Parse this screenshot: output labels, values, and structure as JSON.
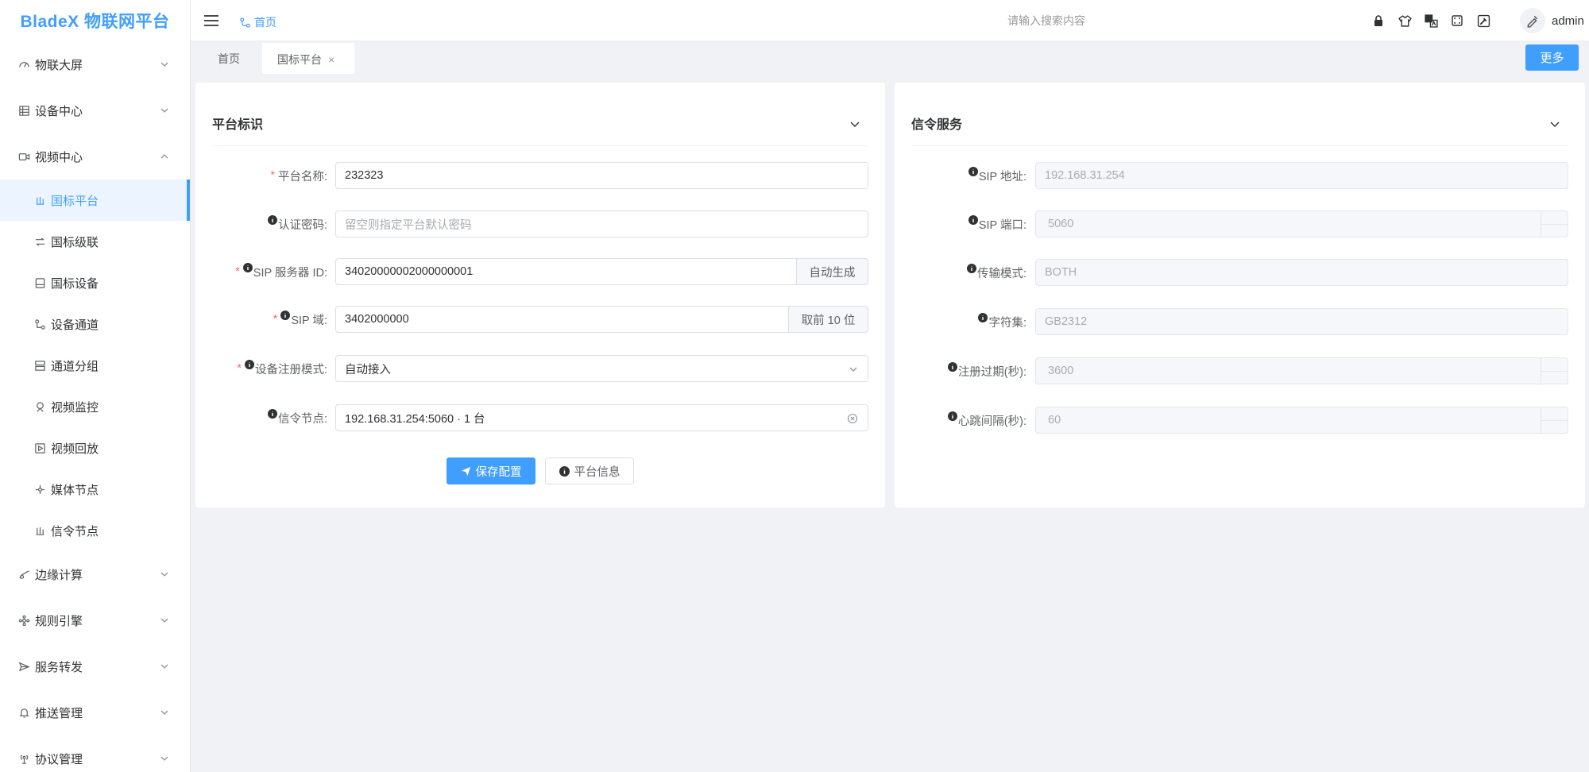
{
  "app": {
    "logo": "BladeX 物联网平台"
  },
  "header": {
    "breadcrumb": "首页",
    "search_placeholder": "请输入搜索内容",
    "user": "admin"
  },
  "sidebar": {
    "groups": [
      {
        "label": "物联大屏",
        "icon": "dashboard-icon",
        "expanded": false
      },
      {
        "label": "设备中心",
        "icon": "device-icon",
        "expanded": false
      },
      {
        "label": "视频中心",
        "icon": "video-icon",
        "expanded": true
      },
      {
        "label": "边缘计算",
        "icon": "edge-icon",
        "expanded": false
      },
      {
        "label": "规则引擎",
        "icon": "rule-icon",
        "expanded": false
      },
      {
        "label": "服务转发",
        "icon": "send-icon",
        "expanded": false
      },
      {
        "label": "推送管理",
        "icon": "bell-icon",
        "expanded": false
      },
      {
        "label": "协议管理",
        "icon": "protocol-icon",
        "expanded": false
      }
    ],
    "video_children": [
      {
        "label": "国标平台",
        "active": true
      },
      {
        "label": "国标级联",
        "active": false
      },
      {
        "label": "国标设备",
        "active": false
      },
      {
        "label": "设备通道",
        "active": false
      },
      {
        "label": "通道分组",
        "active": false
      },
      {
        "label": "视频监控",
        "active": false
      },
      {
        "label": "视频回放",
        "active": false
      },
      {
        "label": "媒体节点",
        "active": false
      },
      {
        "label": "信令节点",
        "active": false
      }
    ]
  },
  "tabs": {
    "home": "首页",
    "active": "国标平台",
    "close": "×",
    "more": "更多"
  },
  "platform": {
    "title": "平台标识",
    "name_label": "平台名称:",
    "name_value": "232323",
    "password_label": "认证密码:",
    "password_placeholder": "留空则指定平台默认密码",
    "sip_id_label": "SIP 服务器 ID:",
    "sip_id_value": "34020000002000000001",
    "sip_id_button": "自动生成",
    "sip_domain_label": "SIP 域:",
    "sip_domain_value": "3402000000",
    "sip_domain_button": "取前 10 位",
    "register_mode_label": "设备注册模式:",
    "register_mode_value": "自动接入",
    "signal_node_label": "信令节点:",
    "signal_node_value": "192.168.31.254:5060 · 1 台",
    "save_button": "保存配置",
    "info_button": "平台信息"
  },
  "signal": {
    "title": "信令服务",
    "sip_addr_label": "SIP 地址:",
    "sip_addr_value": "192.168.31.254",
    "sip_port_label": "SIP 端口:",
    "sip_port_value": "5060",
    "transport_label": "传输模式:",
    "transport_value": "BOTH",
    "charset_label": "字符集:",
    "charset_value": "GB2312",
    "expire_label": "注册过期(秒):",
    "expire_value": "3600",
    "heartbeat_label": "心跳间隔(秒):",
    "heartbeat_value": "60"
  },
  "colors": {
    "primary": "#409eff",
    "required": "#f56c6c"
  }
}
